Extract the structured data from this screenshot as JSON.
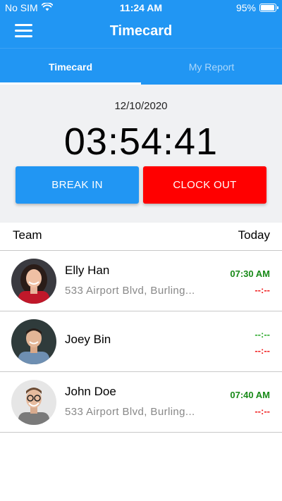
{
  "status_bar": {
    "carrier": "No SIM",
    "time": "11:24 AM",
    "battery": "95%",
    "battery_level": 0.95,
    "icons": [
      "wifi-icon",
      "battery-icon"
    ]
  },
  "app_bar": {
    "title": "Timecard",
    "menu_icon": "hamburger-menu-icon"
  },
  "tabs": [
    {
      "label": "Timecard",
      "active": true
    },
    {
      "label": "My Report",
      "active": false
    }
  ],
  "clock": {
    "date": "12/10/2020",
    "elapsed": "03:54:41",
    "break_label": "BREAK IN",
    "clockout_label": "CLOCK OUT"
  },
  "list": {
    "col_team": "Team",
    "col_today": "Today",
    "members": [
      {
        "name": "Elly Han",
        "address": "533 Airport Blvd, Burling...",
        "in": "07:30 AM",
        "out": "--:--"
      },
      {
        "name": "Joey Bin",
        "address": "",
        "in": "--:--",
        "out": "--:--"
      },
      {
        "name": "John Doe",
        "address": "533 Airport Blvd, Burling...",
        "in": "07:40 AM",
        "out": "--:--"
      }
    ]
  },
  "colors": {
    "primary": "#2196f3",
    "clock_out": "#ff0000",
    "time_in": "#188a18",
    "time_out": "#f02020"
  }
}
